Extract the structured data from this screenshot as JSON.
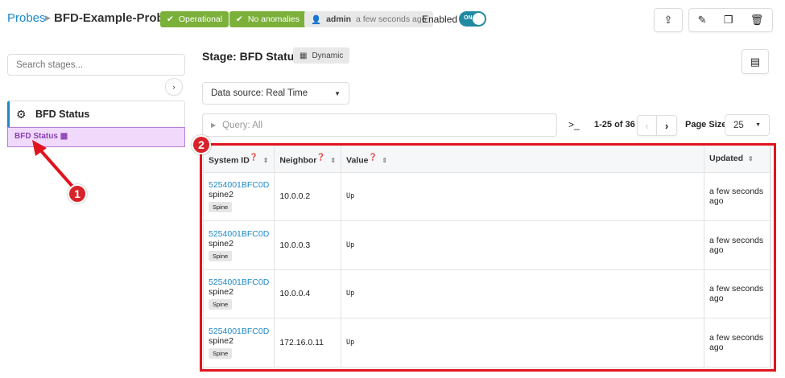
{
  "breadcrumb": {
    "parent": "Probes",
    "current": "BFD-Example-Probe"
  },
  "badges": {
    "operational": "Operational",
    "anomalies": "No anomalies",
    "user": "admin",
    "time": "a few seconds ago"
  },
  "enabled": {
    "label": "Enabled",
    "state": "ON"
  },
  "sidebar": {
    "search_placeholder": "Search stages...",
    "processor": "BFD Status",
    "stage": "BFD Status"
  },
  "stage": {
    "title": "Stage: BFD Status",
    "type": "Dynamic",
    "data_source": "Data source: Real Time",
    "query": "Query: All"
  },
  "pagination": {
    "range": "1-25 of 36",
    "page_size_label": "Page Size:",
    "page_size": "25"
  },
  "table": {
    "headers": [
      "System ID",
      "Neighbor",
      "Value",
      "Updated"
    ],
    "rows": [
      {
        "system_id": "5254001BFC0D",
        "host": "spine2",
        "role": "Spine",
        "neighbor": "10.0.0.2",
        "value": "Up",
        "updated": "a few seconds ago"
      },
      {
        "system_id": "5254001BFC0D",
        "host": "spine2",
        "role": "Spine",
        "neighbor": "10.0.0.3",
        "value": "Up",
        "updated": "a few seconds ago"
      },
      {
        "system_id": "5254001BFC0D",
        "host": "spine2",
        "role": "Spine",
        "neighbor": "10.0.0.4",
        "value": "Up",
        "updated": "a few seconds ago"
      },
      {
        "system_id": "5254001BFC0D",
        "host": "spine2",
        "role": "Spine",
        "neighbor": "172.16.0.11",
        "value": "Up",
        "updated": "a few seconds ago"
      }
    ]
  },
  "callouts": [
    "1",
    "2"
  ],
  "colors": {
    "accent": "#1e88c7",
    "green": "#7bb03a",
    "callout": "#d8232a",
    "highlight": "#f0d9fb"
  }
}
